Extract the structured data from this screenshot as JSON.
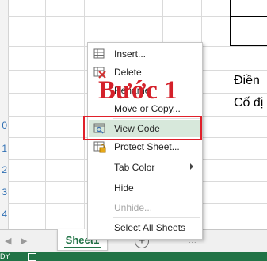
{
  "rows": {
    "numbers": [
      "0",
      "1",
      "2",
      "3",
      "4"
    ]
  },
  "cells": {
    "text_1": "Điền",
    "text_2": "Cố đị"
  },
  "context_menu": {
    "items": [
      {
        "label": "Insert...",
        "icon": "insert-icon",
        "enabled": true
      },
      {
        "label": "Delete",
        "icon": "delete-sheet-icon",
        "enabled": true
      },
      {
        "label": "Rename",
        "icon": "",
        "enabled": true
      },
      {
        "label": "Move or Copy...",
        "icon": "",
        "enabled": true
      },
      {
        "label": "View Code",
        "icon": "view-code-icon",
        "enabled": true,
        "highlighted": true
      },
      {
        "label": "Protect Sheet...",
        "icon": "protect-sheet-icon",
        "enabled": true
      },
      {
        "label": "Tab Color",
        "icon": "",
        "enabled": true,
        "submenu": true
      },
      {
        "label": "Hide",
        "icon": "",
        "enabled": true
      },
      {
        "label": "Unhide...",
        "icon": "",
        "enabled": false
      },
      {
        "label": "Select All Sheets",
        "icon": "",
        "enabled": true
      }
    ]
  },
  "annotation": {
    "step_label": "Bước 1",
    "color": "#d4202a"
  },
  "sheet_tabs": {
    "active": "Sheet1",
    "add_symbol": "+",
    "more": "..."
  },
  "status_bar": {
    "text": "DY",
    "color": "#217346"
  }
}
